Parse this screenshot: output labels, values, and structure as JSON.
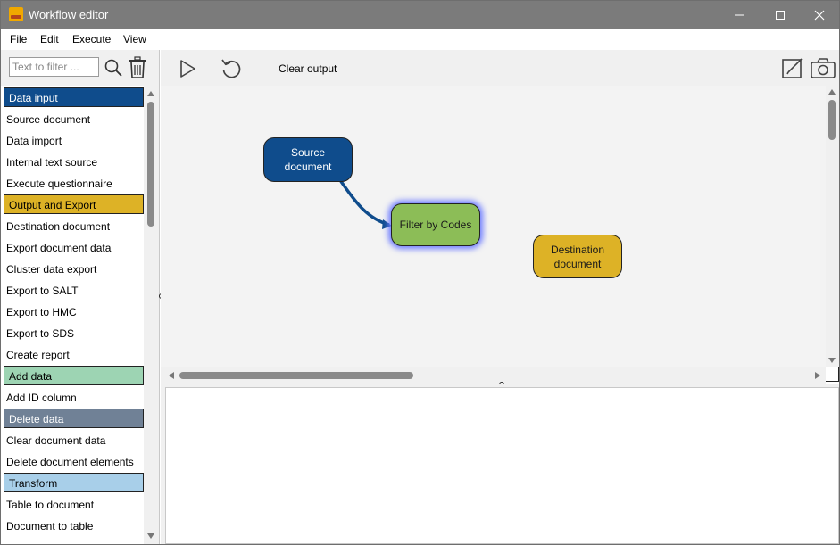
{
  "window": {
    "title": "Workflow editor"
  },
  "menu": {
    "items": [
      "File",
      "Edit",
      "Execute",
      "View"
    ]
  },
  "sidebar": {
    "filter_placeholder": "Text to filter ...",
    "items": [
      {
        "label": "Data input",
        "category": true,
        "style": "input"
      },
      {
        "label": "Source document"
      },
      {
        "label": "Data import"
      },
      {
        "label": "Internal text source"
      },
      {
        "label": "Execute questionnaire"
      },
      {
        "label": "Output and Export",
        "category": true,
        "style": "output"
      },
      {
        "label": "Destination document"
      },
      {
        "label": "Export document data"
      },
      {
        "label": "Cluster data export"
      },
      {
        "label": "Export to SALT"
      },
      {
        "label": "Export to HMC"
      },
      {
        "label": "Export to SDS"
      },
      {
        "label": "Create report"
      },
      {
        "label": "Add data",
        "category": true,
        "style": "add"
      },
      {
        "label": "Add ID column"
      },
      {
        "label": "Delete data",
        "category": true,
        "style": "delete"
      },
      {
        "label": "Clear document data"
      },
      {
        "label": "Delete document elements"
      },
      {
        "label": "Transform",
        "category": true,
        "style": "transform"
      },
      {
        "label": "Table to document"
      },
      {
        "label": "Document to table"
      }
    ]
  },
  "toolbar": {
    "clear_output": "Clear output"
  },
  "canvas": {
    "nodes": {
      "source": {
        "label": "Source document"
      },
      "filter": {
        "label": "Filter by Codes"
      },
      "destination": {
        "label": "Destination document"
      }
    }
  },
  "colors": {
    "titlebar": "#7b7b7b",
    "data_input": "#0f4c8c",
    "output_export": "#ddb226",
    "add_data": "#9dd4b3",
    "delete_data": "#708196",
    "transform": "#a8cfe9",
    "filter_node": "#8cbd57",
    "connector": "#0f4c8c"
  }
}
